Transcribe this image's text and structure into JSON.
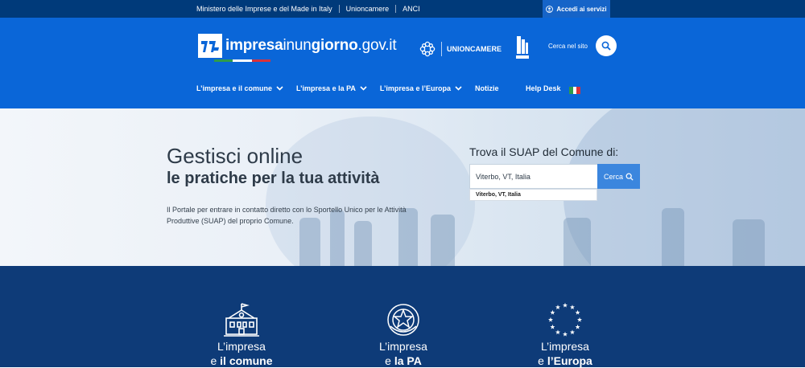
{
  "topbar": {
    "links": [
      "Ministero delle Imprese e del Made in Italy",
      "Unioncamere",
      "ANCI"
    ],
    "access_label": "Accedi ai servizi"
  },
  "header": {
    "logo_strong": "impresa",
    "logo_light": "inun",
    "logo_strong2": "giorno",
    "logo_tld": ".gov.it",
    "unioncamere": "UNIONCAMERE",
    "search_label": "Cerca nel sito",
    "nav": [
      "L’impresa e il comune",
      "L’impresa e la PA",
      "L’impresa e l’Europa",
      "Notizie"
    ],
    "helpdesk": "Help Desk"
  },
  "hero": {
    "title_line1": "Gestisci online",
    "title_line2": "le pratiche per la tua attività",
    "description": "Il Portale per entrare in contatto diretto con lo Sportello Unico per le Attività Produttive (SUAP) del proprio Comune.",
    "suap_label": "Trova il SUAP del Comune di:",
    "suap_value": "Viterbo, VT, Italia",
    "suap_button": "Cerca",
    "suggestion": "Viterbo, VT, Italia"
  },
  "cards": [
    {
      "light": "L’impresa",
      "prefix": "e ",
      "bold": "il comune",
      "icon": "town-hall-icon"
    },
    {
      "light": "L’impresa",
      "prefix": "e ",
      "bold": "la PA",
      "icon": "italian-emblem-icon"
    },
    {
      "light": "L’impresa",
      "prefix": "e ",
      "bold": "l’Europa",
      "icon": "eu-stars-icon"
    }
  ],
  "colors": {
    "header": "#0a66d8",
    "topbar": "#003a7a",
    "bottom": "#0e3b78",
    "button": "#3b86de"
  }
}
